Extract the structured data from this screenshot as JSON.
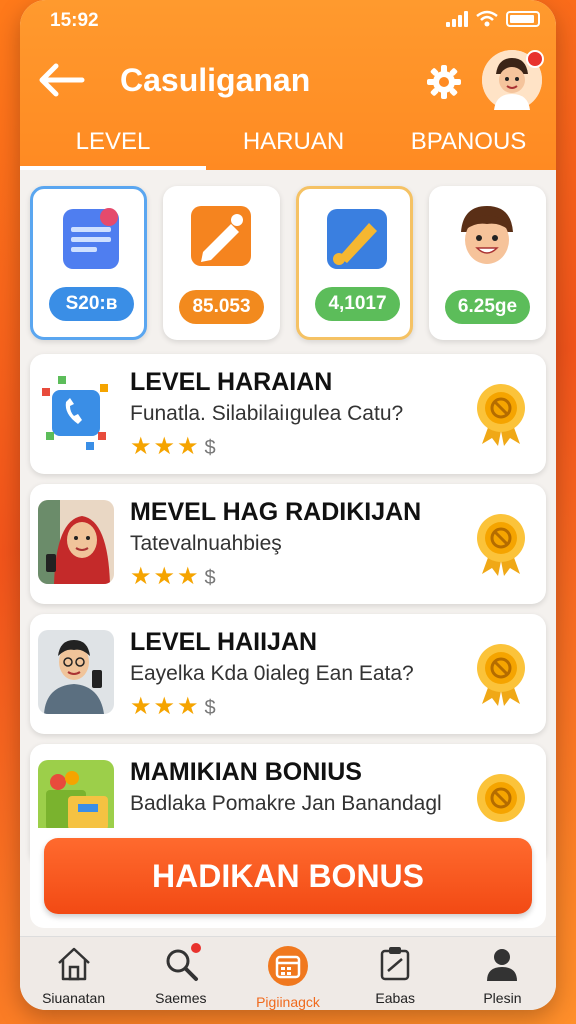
{
  "status": {
    "time": "15:92"
  },
  "header": {
    "title": "Casuliganan"
  },
  "tabs": [
    {
      "label": "LEVEL",
      "active": true
    },
    {
      "label": "HARUAN",
      "active": false
    },
    {
      "label": "BPANOUS",
      "active": false
    }
  ],
  "cards": [
    {
      "icon": "document-icon",
      "value": "S20:ʙ",
      "color": "#3a8ee6"
    },
    {
      "icon": "pencil-icon",
      "value": "85.053",
      "color": "#f28a1e"
    },
    {
      "icon": "brush-icon",
      "value": "4,1017",
      "color": "#5cbd5a"
    },
    {
      "icon": "boy-avatar-icon",
      "value": "6.25ge",
      "color": "#5cbd5a"
    }
  ],
  "list": [
    {
      "title": "LEVEL HARAIAN",
      "subtitle": "Funatla. Silabilaiıgulea Catu?",
      "stars": "★★★",
      "currency": "$",
      "thumb": "phone-app-icon"
    },
    {
      "title": "MEVEL HAG RADIKIJAN",
      "subtitle": "Tatevalnuahbieş",
      "stars": "★★★",
      "currency": "$",
      "thumb": "woman-photo"
    },
    {
      "title": "LEVEL HAIIJAN",
      "subtitle": "Eayelka Kda 0ialeg Ean Eata?",
      "stars": "★★★",
      "currency": "$",
      "thumb": "man-photo"
    },
    {
      "title": "MAMIKIAN BONIUS",
      "subtitle": "Badlaka Pomakre Jan Banandagl",
      "stars": "",
      "currency": "",
      "thumb": "gift-basket-icon"
    }
  ],
  "cta": {
    "label": "HADIKAN BONUS"
  },
  "nav": [
    {
      "label": "Siuanatan",
      "icon": "home-icon"
    },
    {
      "label": "Saemes",
      "icon": "search-icon"
    },
    {
      "label": "Pigiinagck",
      "icon": "calendar-icon"
    },
    {
      "label": "Eabas",
      "icon": "tasks-icon"
    },
    {
      "label": "Plesin",
      "icon": "profile-icon"
    }
  ],
  "colors": {
    "brand": "#ff8a22",
    "cta": "#f24a14",
    "star": "#f5a400"
  }
}
